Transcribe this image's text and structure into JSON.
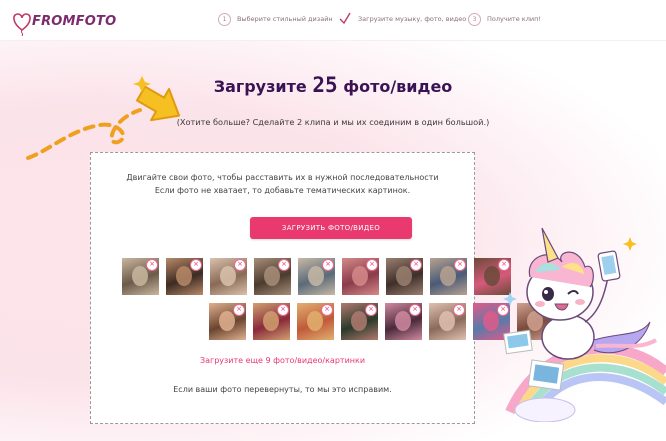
{
  "brand": {
    "logo_text": "FROMFOTO"
  },
  "steps": [
    {
      "num": "1",
      "label": "Выберите стильный дизайн",
      "done": false
    },
    {
      "num": "",
      "label": "Загрузите музыку, фото, видео",
      "done": true
    },
    {
      "num": "3",
      "label": "Получите клип!",
      "done": false
    }
  ],
  "title": {
    "prefix": "Загрузите",
    "count": "25",
    "suffix": "фото/видео"
  },
  "subtitle": "(Хотите больше? Сделайте 2 клипа и мы их соединим в один большой.)",
  "dropzone": {
    "instruction_line1": "Двигайте свои фото, чтобы расставить их в нужной последовательности",
    "instruction_line2": "Если фото не хватает, то добавьте тематических картинок.",
    "upload_button": "ЗАГРУЗИТЬ ФОТО/ВИДЕО",
    "more_text": "Загрузите еще 9 фото/видео/картинки",
    "flip_text": "Если ваши фото перевернуты, то мы это исправим."
  },
  "photos": [
    {
      "c1": "#6b5a4a",
      "c2": "#c9b79f"
    },
    {
      "c1": "#3d2b22",
      "c2": "#b88a6a"
    },
    {
      "c1": "#8a6a55",
      "c2": "#d9c2ad"
    },
    {
      "c1": "#4b3b2e",
      "c2": "#a88e79"
    },
    {
      "c1": "#5a6b78",
      "c2": "#c7b9a6"
    },
    {
      "c1": "#8b3b4a",
      "c2": "#d48a8a"
    },
    {
      "c1": "#3f2f2a",
      "c2": "#9a8070"
    },
    {
      "c1": "#4a5a78",
      "c2": "#b8a290"
    },
    {
      "c1": "#d65a7a",
      "c2": "#6a4a3a"
    },
    {
      "c1": "#6a4530",
      "c2": "#e0b08f"
    },
    {
      "c1": "#8a2a3a",
      "c2": "#d0a070"
    },
    {
      "c1": "#c05a3a",
      "c2": "#e2b070"
    },
    {
      "c1": "#2a3a2a",
      "c2": "#b07a70"
    },
    {
      "c1": "#4a2a3a",
      "c2": "#d08aa0"
    },
    {
      "c1": "#8a6a5a",
      "c2": "#e0c0b0"
    },
    {
      "c1": "#5a7aa8",
      "c2": "#e05a8a"
    },
    {
      "c1": "#7a4a3a",
      "c2": "#d0a090"
    }
  ],
  "delete_glyph": "×",
  "colors": {
    "accent": "#e9396f",
    "title": "#3a1354"
  }
}
